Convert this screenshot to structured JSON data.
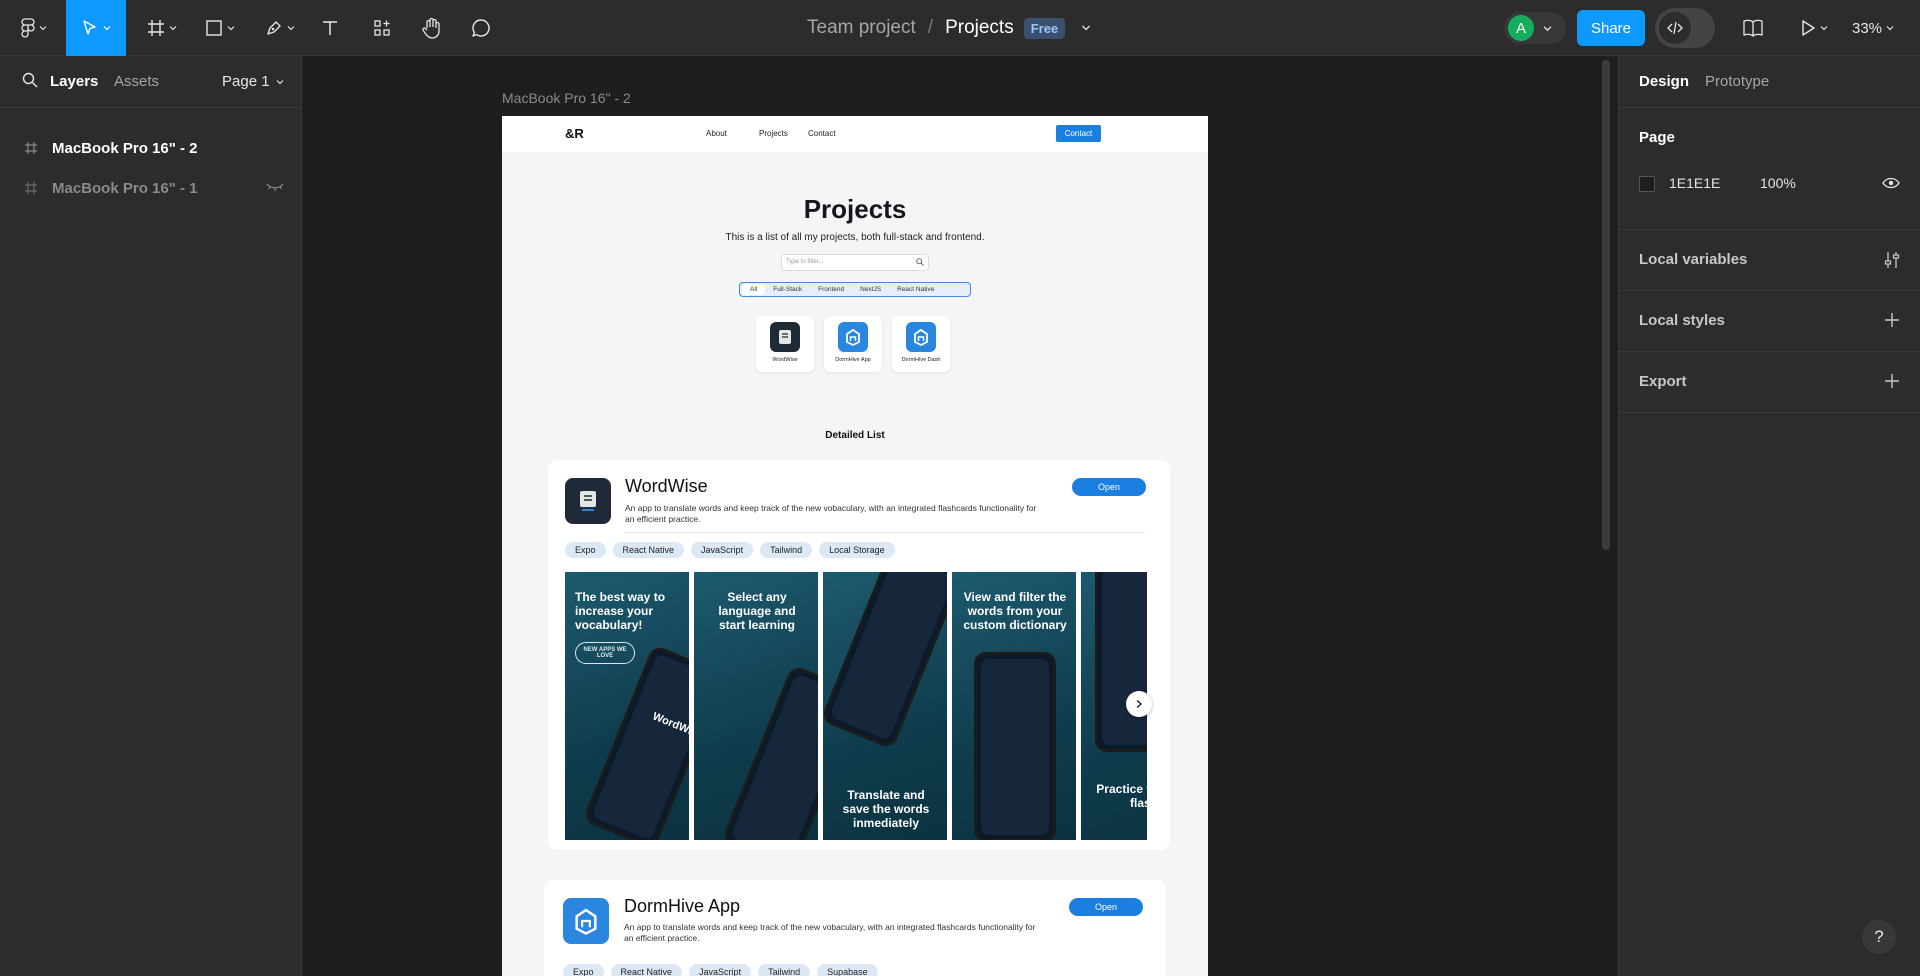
{
  "toolbar": {
    "breadcrumb_team": "Team project",
    "breadcrumb_sep": "/",
    "breadcrumb_file": "Projects",
    "plan_badge": "Free",
    "avatar_initial": "A",
    "share_label": "Share",
    "zoom": "33%",
    "accent": "#0d99ff"
  },
  "left_panel": {
    "tab_layers": "Layers",
    "tab_assets": "Assets",
    "page_selector": "Page 1",
    "layers": [
      {
        "name": "MacBook Pro 16\" - 2"
      },
      {
        "name": "MacBook Pro 16\" - 1"
      }
    ]
  },
  "canvas": {
    "frame_label": "MacBook Pro 16\" - 2",
    "site": {
      "logo": "&R",
      "nav": [
        "About",
        "Projects",
        "Contact"
      ],
      "contact_button": "Contact",
      "title": "Projects",
      "subtitle": "This is a list of all my projects, both full-stack and frontend.",
      "search_placeholder": "Type to filter...",
      "filters": [
        "All",
        "Full-Stack",
        "Frontend",
        "NextJS",
        "React Native"
      ],
      "apps": [
        {
          "name": "WordWise"
        },
        {
          "name": "DormHive App"
        },
        {
          "name": "DormHive Dash"
        }
      ],
      "detailed_heading": "Detailed List",
      "cards": [
        {
          "title": "WordWise",
          "description": "An app to translate words and keep track of the new vobaculary, with an integrated flashcards functionality for an efficient practice.",
          "open_label": "Open",
          "tags": [
            "Expo",
            "React Native",
            "JavaScript",
            "Tailwind",
            "Local Storage"
          ],
          "screenshots": [
            {
              "text": "The best way to increase your vocabulary!",
              "badge": "NEW APPS WE LOVE",
              "brand": "WordWise"
            },
            {
              "text": "Select any language and start learning"
            },
            {
              "text": "Translate and save the words inmediately"
            },
            {
              "text": "View and filter the words from your custom dictionary"
            },
            {
              "text": "Practice vocabul flash"
            }
          ]
        },
        {
          "title": "DormHive App",
          "description": "An app to translate words and keep track of the new vobaculary, with an integrated flashcards functionality for an efficient practice.",
          "open_label": "Open",
          "tags": [
            "Expo",
            "React Native",
            "JavaScript",
            "Tailwind",
            "Supabase"
          ]
        }
      ]
    }
  },
  "right_panel": {
    "tab_design": "Design",
    "tab_prototype": "Prototype",
    "page_heading": "Page",
    "page_color": "1E1E1E",
    "page_opacity": "100%",
    "sections": [
      "Local variables",
      "Local styles",
      "Export"
    ]
  },
  "help_label": "?"
}
